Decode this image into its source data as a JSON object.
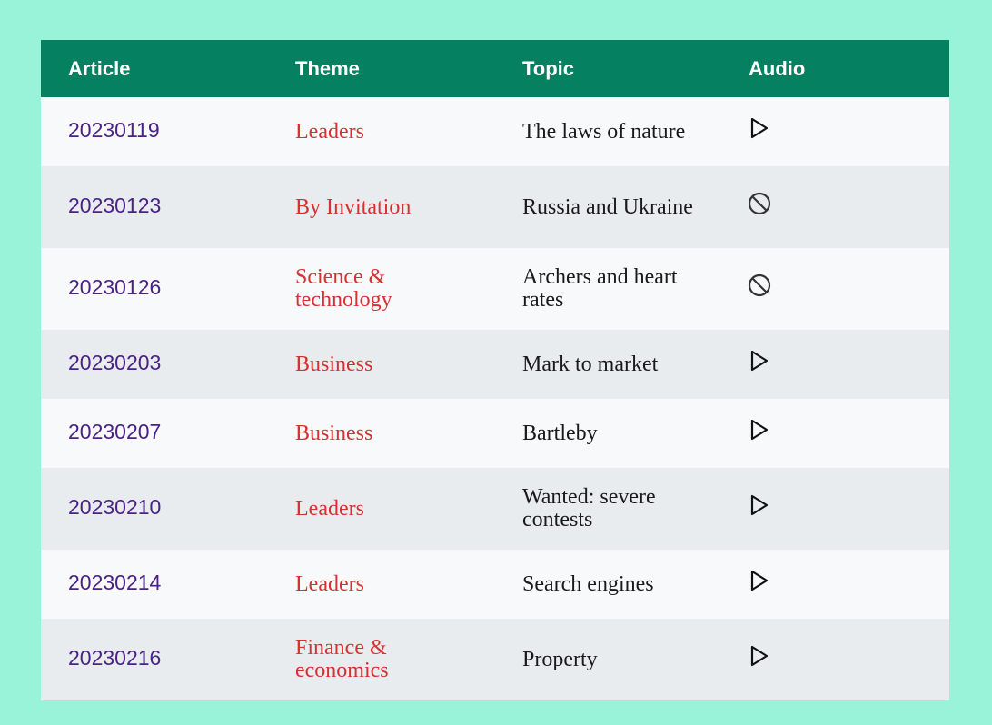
{
  "table": {
    "headers": [
      "Article",
      "Theme",
      "Topic",
      "Audio"
    ],
    "rows": [
      {
        "article": "20230119",
        "theme": "Leaders",
        "topic": "The laws of nature",
        "audio": "play-icon"
      },
      {
        "article": "20230123",
        "theme": "By Invitation",
        "topic": "Russia and Ukraine",
        "audio": "unavailable-icon"
      },
      {
        "article": "20230126",
        "theme": "Science & technology",
        "topic": "Archers and heart rates",
        "audio": "unavailable-icon"
      },
      {
        "article": "20230203",
        "theme": "Business",
        "topic": "Mark to market",
        "audio": "play-icon"
      },
      {
        "article": "20230207",
        "theme": "Business",
        "topic": "Bartleby",
        "audio": "play-icon"
      },
      {
        "article": "20230210",
        "theme": "Leaders",
        "topic": "Wanted: severe contests",
        "audio": "play-icon"
      },
      {
        "article": "20230214",
        "theme": "Leaders",
        "topic": "Search engines",
        "audio": "play-icon"
      },
      {
        "article": "20230216",
        "theme": "Finance & economics",
        "topic": "Property",
        "audio": "play-icon"
      }
    ]
  },
  "colors": {
    "page_background": "#98f3d8",
    "header_background": "#058060",
    "article_text": "#4b2286",
    "theme_text": "#d63032"
  }
}
